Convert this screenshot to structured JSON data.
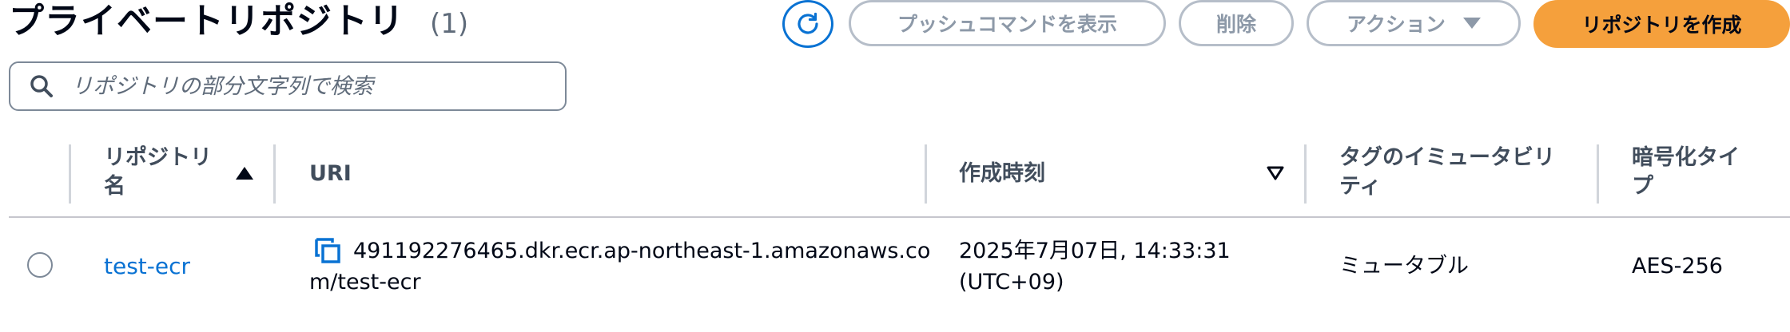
{
  "header": {
    "title": "プライベートリポジトリ",
    "count": "(1)"
  },
  "toolbar": {
    "refresh_icon": "refresh-icon",
    "push_commands_label": "プッシュコマンドを表示",
    "delete_label": "削除",
    "actions_label": "アクション",
    "create_label": "リポジトリを作成"
  },
  "search": {
    "placeholder": "リポジトリの部分文字列で検索",
    "value": ""
  },
  "table": {
    "columns": [
      {
        "label_line1": "リポジトリ",
        "label_line2": "名",
        "sort": "ascending"
      },
      {
        "label": "URI"
      },
      {
        "label": "作成時刻",
        "sort": "descending"
      },
      {
        "label_line1": "タグのイミュータビリ",
        "label_line2": "ティ"
      },
      {
        "label_line1": "暗号化タイ",
        "label_line2": "プ"
      }
    ],
    "rows": [
      {
        "selected": false,
        "name": "test-ecr",
        "uri_line1": "491192276465.dkr.ecr.ap-northeast-1.amazonaws.co",
        "uri_line2": "m/test-ecr",
        "created_line1": "2025年7月07日, 14:33:31",
        "created_line2": "(UTC+09)",
        "tag_mutability": "ミュータブル",
        "encryption": "AES-256"
      }
    ]
  },
  "colors": {
    "primary_button": "#f5a03c",
    "link": "#0972d3",
    "disabled_border": "#b6bec9"
  }
}
